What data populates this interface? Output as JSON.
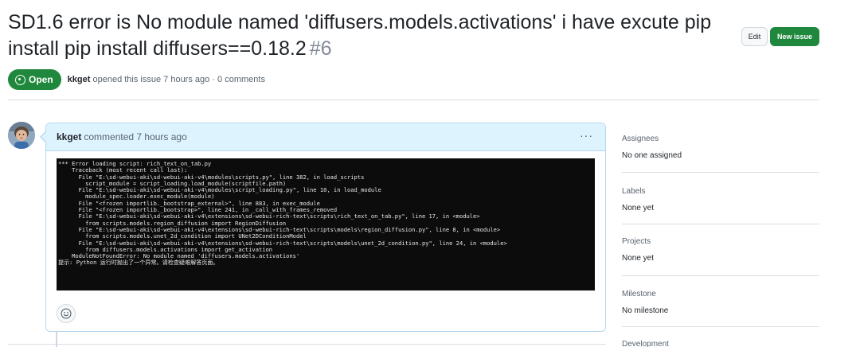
{
  "issue": {
    "title": "SD1.6 error is No module named 'diffusers.models.activations' i have excute pip install pip install diffusers==0.18.2",
    "number": "#6",
    "state": "Open",
    "author": "kkget",
    "meta_text": "opened this issue 7 hours ago · 0 comments"
  },
  "header_actions": {
    "edit_label": "Edit",
    "new_issue_label": "New issue"
  },
  "comment": {
    "author": "kkget",
    "time_text": "commented 7 hours ago",
    "options_label": "···",
    "terminal_lines": [
      "*** Error loading script: rich_text_on_tab.py",
      "    Traceback (most recent call last):",
      "      File \"E:\\sd-webui-aki\\sd-webui-aki-v4\\modules\\scripts.py\", line 382, in load_scripts",
      "        script_module = script_loading.load_module(scriptfile.path)",
      "      File \"E:\\sd-webui-aki\\sd-webui-aki-v4\\modules\\script_loading.py\", line 10, in load_module",
      "        module_spec.loader.exec_module(module)",
      "      File \"<frozen importlib._bootstrap_external>\", line 883, in exec_module",
      "      File \"<frozen importlib._bootstrap>\", line 241, in _call_with_frames_removed",
      "      File \"E:\\sd-webui-aki\\sd-webui-aki-v4\\extensions\\sd-webui-rich-text\\scripts\\rich_text_on_tab.py\", line 17, in <module>",
      "        from scripts.models.region_diffusion import RegionDiffusion",
      "      File \"E:\\sd-webui-aki\\sd-webui-aki-v4\\extensions\\sd-webui-rich-text\\scripts\\models\\region_diffusion.py\", line 8, in <module>",
      "        from scripts.models.unet_2d_condition import UNet2DConditionModel",
      "      File \"E:\\sd-webui-aki\\sd-webui-aki-v4\\extensions\\sd-webui-rich-text\\scripts\\models\\unet_2d_condition.py\", line 24, in <module>",
      "        from diffusers.models.activations import get_activation",
      "    ModuleNotFoundError: No module named 'diffusers.models.activations'",
      "提示: Python 运行时抛出了一个异常。请检查疑难解答页面。"
    ]
  },
  "sidebar": {
    "assignees_label": "Assignees",
    "assignees_value": "No one assigned",
    "labels_label": "Labels",
    "labels_value": "None yet",
    "projects_label": "Projects",
    "projects_value": "None yet",
    "milestone_label": "Milestone",
    "milestone_value": "No milestone",
    "development_label": "Development"
  },
  "colors": {
    "open_green": "#1f883d",
    "comment_header_bg": "#ddf4ff",
    "terminal_bg": "#0c0c0c"
  }
}
